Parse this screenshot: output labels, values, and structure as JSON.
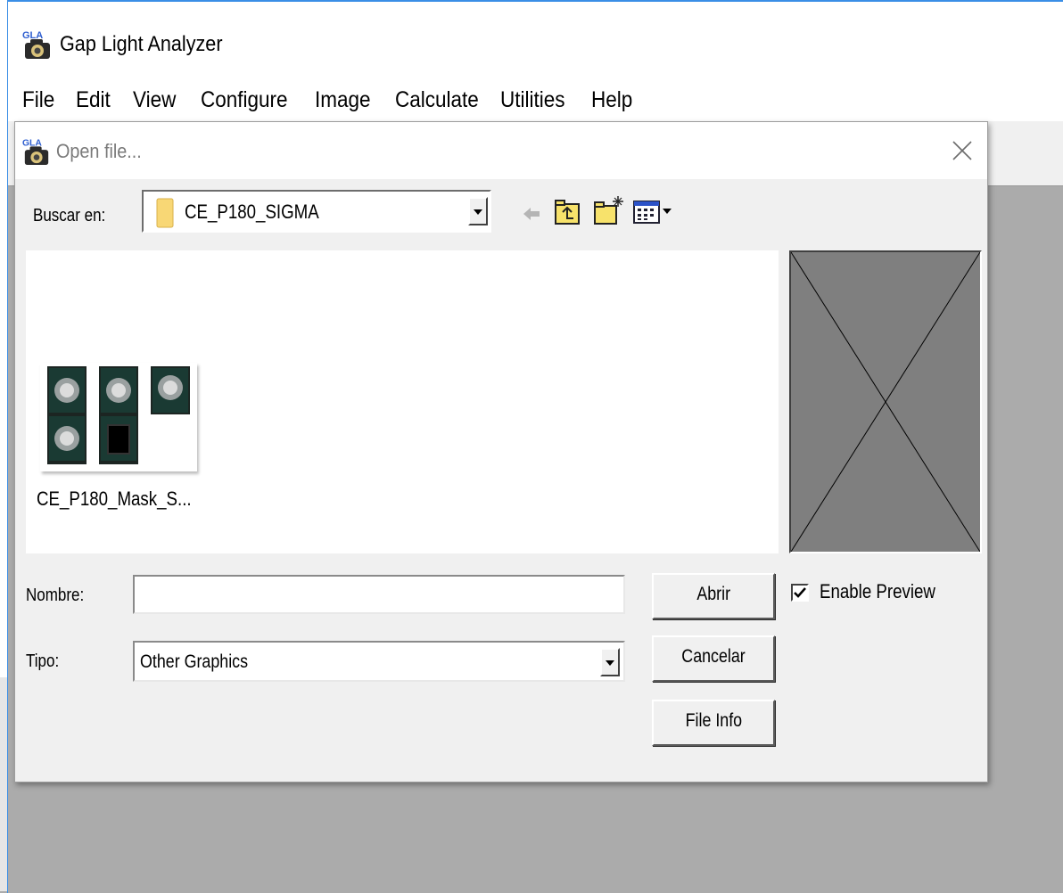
{
  "app": {
    "title": "Gap Light Analyzer",
    "icon": "gla-camera-icon",
    "menu": [
      "File",
      "Edit",
      "View",
      "Configure",
      "Image",
      "Calculate",
      "Utilities",
      "Help"
    ]
  },
  "dialog": {
    "title": "Open file...",
    "look_in": {
      "label": "Buscar en:",
      "value": "CE_P180_SIGMA",
      "icon": "folder-icon"
    },
    "toolbar_icons": [
      "back-arrow-icon",
      "up-folder-icon",
      "new-folder-icon",
      "view-menu-icon"
    ],
    "files": [
      {
        "name": "CE_P180_Mask_S...",
        "icon": "image-thumbnail-icon"
      }
    ],
    "filename": {
      "label": "Nombre:",
      "value": ""
    },
    "file_type": {
      "label": "Tipo:",
      "value": "Other Graphics"
    },
    "buttons": {
      "open": "Abrir",
      "cancel": "Cancelar",
      "file_info": "File Info"
    },
    "preview": {
      "label": "Enable Preview",
      "checked": true
    }
  },
  "colors": {
    "accent_border": "#3a8ee6",
    "dialog_bg": "#f0f0f0",
    "workspace_bg": "#ababab",
    "preview_bg": "#7f7f7f"
  }
}
